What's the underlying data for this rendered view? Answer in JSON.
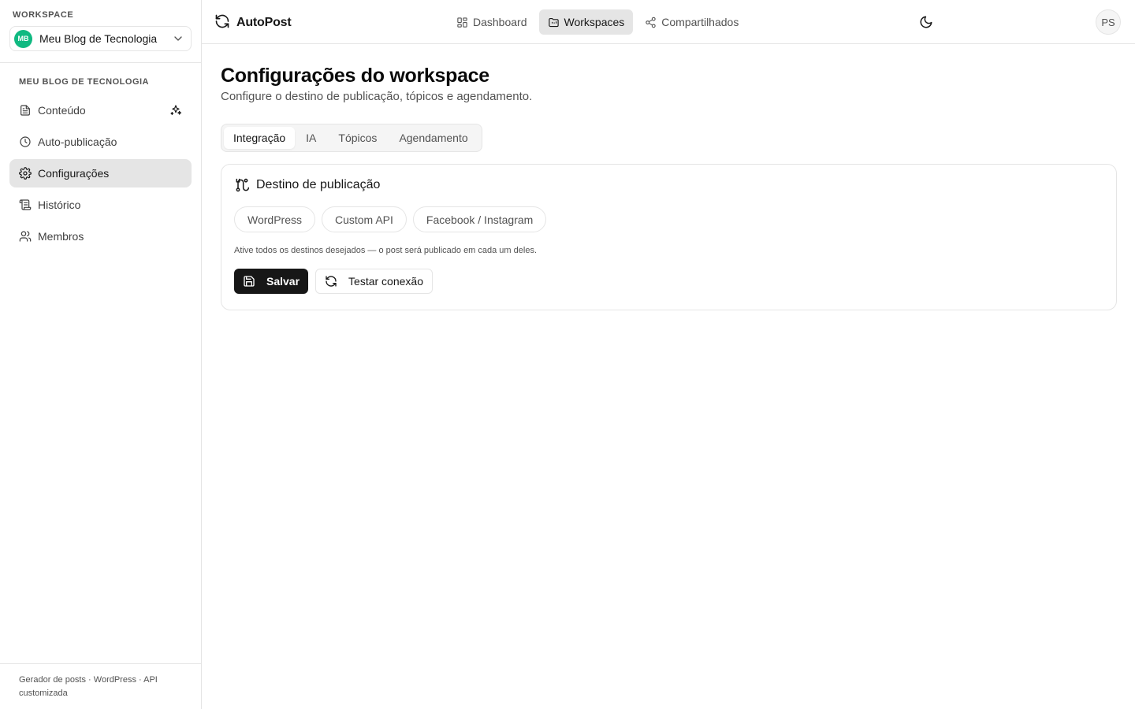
{
  "workspace": {
    "label": "WORKSPACE",
    "avatar_initials": "MB",
    "avatar_color": "#10b981",
    "name": "Meu Blog de Tecnologia"
  },
  "sidebar": {
    "section_label": "MEU BLOG DE TECNOLOGIA",
    "items": [
      {
        "label": "Conteúdo",
        "icon": "file-text-icon"
      },
      {
        "label": "Auto-publicação",
        "icon": "clock-icon"
      },
      {
        "label": "Configurações",
        "icon": "gear-icon",
        "active": true
      },
      {
        "label": "Histórico",
        "icon": "scroll-icon"
      },
      {
        "label": "Membros",
        "icon": "users-icon"
      }
    ],
    "footer": "Gerador de posts · WordPress · API customizada"
  },
  "topbar": {
    "brand": "AutoPost",
    "nav": [
      {
        "label": "Dashboard",
        "icon": "grid-icon"
      },
      {
        "label": "Workspaces",
        "icon": "folder-icon",
        "active": true
      },
      {
        "label": "Compartilhados",
        "icon": "share-icon"
      }
    ],
    "user_initials": "PS"
  },
  "main": {
    "title": "Configurações do workspace",
    "subtitle": "Configure o destino de publicação, tópicos e agendamento.",
    "tabs": [
      {
        "label": "Integração",
        "active": true
      },
      {
        "label": "IA"
      },
      {
        "label": "Tópicos"
      },
      {
        "label": "Agendamento"
      }
    ],
    "card": {
      "title": "Destino de publicação",
      "destinations": [
        "WordPress",
        "Custom API",
        "Facebook / Instagram"
      ],
      "hint": "Ative todos os destinos desejados — o post será publicado em cada um deles.",
      "save_label": "Salvar",
      "test_label": "Testar conexão"
    }
  },
  "colors": {
    "accent": "#171717",
    "active_bg": "#e5e5e5",
    "border": "#e5e5e5"
  }
}
